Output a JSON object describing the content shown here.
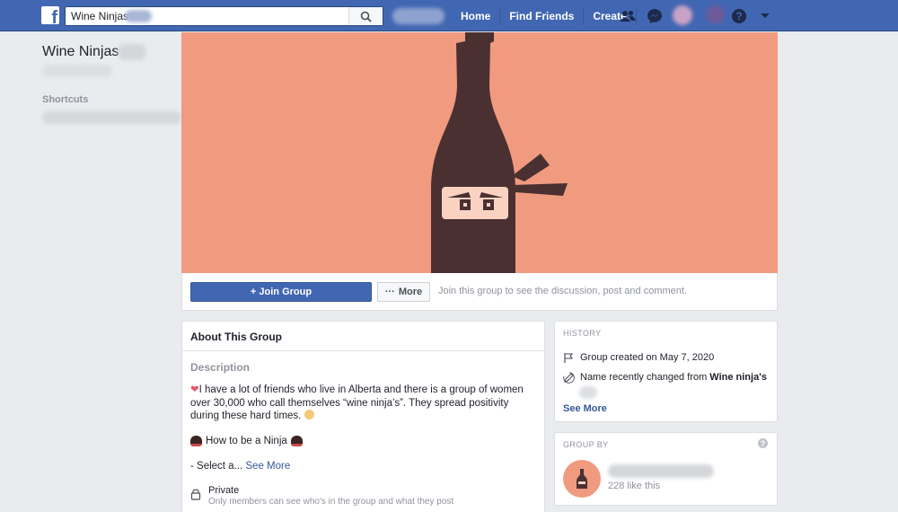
{
  "topbar": {
    "search_value": "Wine Ninjas",
    "nav": [
      "Home",
      "Find Friends",
      "Create"
    ]
  },
  "sidebar": {
    "group_name": "Wine Ninjas",
    "shortcuts_label": "Shortcuts"
  },
  "actions": {
    "join_label": "+ Join Group",
    "more_label": "More",
    "join_hint": "Join this group to see the discussion, post and comment."
  },
  "about": {
    "header": "About This Group",
    "description_label": "Description",
    "description_text": "I have a lot of friends who live in Alberta and there is a group of women over 30,000 who call themselves “wine ninja’s”.  They spread positivity during these hard times.",
    "ninja_line": "How to be a Ninja",
    "select_text": "- Select a...",
    "see_more": "See More",
    "privacy_title": "Private",
    "privacy_sub": "Only members can see who's in the group and what they post"
  },
  "history": {
    "label": "HISTORY",
    "created": "Group created on May 7, 2020",
    "renamed_prefix": "Name recently changed from ",
    "renamed_name": "Wine ninja's",
    "see_more": "See More"
  },
  "group_by": {
    "label": "GROUP BY",
    "help": "?",
    "likes": "228 like this"
  },
  "colors": {
    "brand_blue": "#4267b2",
    "cover_salmon": "#f09a80",
    "bottle_brown": "#4a3030"
  },
  "icons": [
    "facebook-logo-icon",
    "search-icon",
    "friends-icon",
    "messenger-icon",
    "help-icon",
    "dropdown-arrow-icon",
    "lock-icon",
    "flag-icon",
    "pencil-icon",
    "wine-bottle-icon",
    "heart-icon"
  ]
}
